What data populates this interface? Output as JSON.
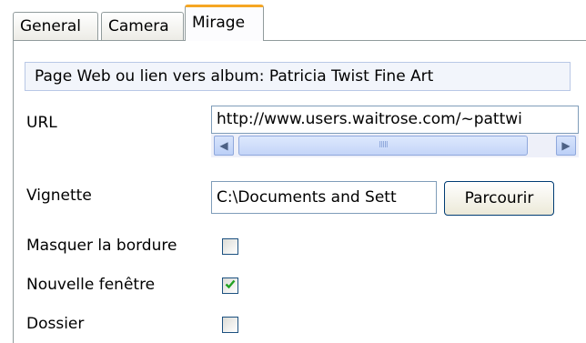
{
  "tabs": [
    {
      "label": "General"
    },
    {
      "label": "Camera"
    },
    {
      "label": "Mirage"
    }
  ],
  "active_tab": "Mirage",
  "mirage": {
    "page_link_header": "Page Web ou lien vers album: Patricia Twist Fine Art",
    "url_label": "URL",
    "url_value": "http://www.users.waitrose.com/~pattwi",
    "scroll_grip": "IIIII",
    "thumbnail_label": "Vignette",
    "thumbnail_value": "C:\\Documents and Sett",
    "browse_button": "Parcourir",
    "hide_border_label": "Masquer la bordure",
    "hide_border_checked": false,
    "new_window_label": "Nouvelle fenêtre",
    "new_window_checked": true,
    "folder_label": "Dossier",
    "folder_checked": false
  }
}
